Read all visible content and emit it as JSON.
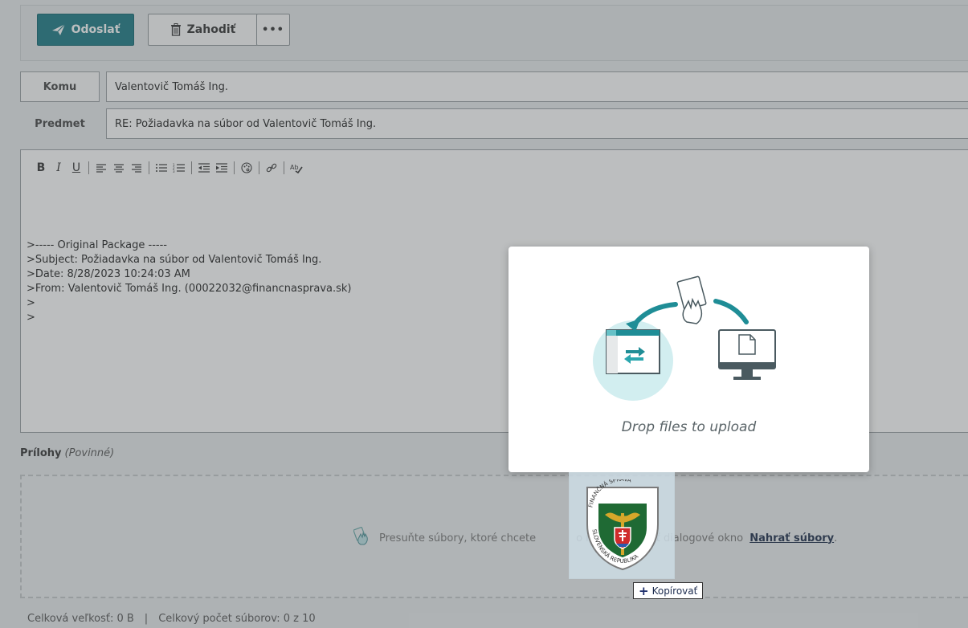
{
  "toolbar": {
    "send_label": "Odoslať",
    "discard_label": "Zahodiť",
    "more_label": "•••"
  },
  "message": {
    "to_label": "Komu",
    "to_value": "Valentovič Tomáš Ing.",
    "subject_label": "Predmet",
    "subject_value": "RE: Požiadavka na súbor od Valentovič Tomáš Ing."
  },
  "editor": {
    "toolbar": {
      "bold": "B",
      "italic": "I",
      "underline": "U"
    },
    "body_lines": [
      ">----- Original Package -----",
      ">Subject: Požiadavka na súbor od Valentovič Tomáš Ing.",
      ">Date: 8/28/2023 10:24:03 AM",
      ">From: Valentovič Tomáš Ing. (00022032@financnasprava.sk)",
      ">",
      ">"
    ]
  },
  "attachments": {
    "title": "Prílohy",
    "required_note": "(Povinné)",
    "dropzone_text_before": "Presuňte súbory, ktoré chcete",
    "dropzone_text_after": "o môžete použiť dialogové okno",
    "upload_link": "Nahrať súbory",
    "dropzone_text_end": "."
  },
  "footer": {
    "total_size": "Celková veľkosť: 0 B",
    "separator": "|",
    "total_count": "Celkový počet súborov: 0 z 10"
  },
  "drop_modal": {
    "text": "Drop files to upload"
  },
  "drag": {
    "logo_top_text": "FINANČNÁ SPRÁVA",
    "logo_bottom_text": "SLOVENSKÁ REPUBLIKA",
    "copy_tooltip": "Kopírovať"
  },
  "colors": {
    "primary": "#1a7a85",
    "accent_teal": "#2a9aa0",
    "link": "#1c2c4a"
  }
}
